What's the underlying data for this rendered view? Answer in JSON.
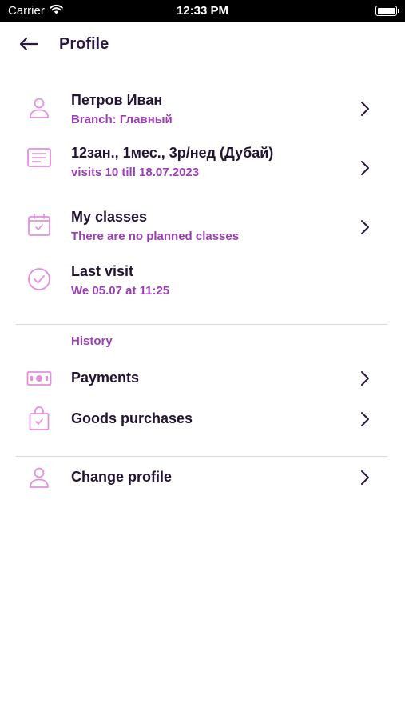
{
  "status_bar": {
    "carrier": "Carrier",
    "time": "12:33 PM"
  },
  "header": {
    "title": "Profile"
  },
  "profile": {
    "name": "Петров Иван",
    "branch": "Branch: Главный"
  },
  "subscription": {
    "title": "12зан., 1мес., 3р/нед (Дубай)",
    "subtitle": "visits 10 till 18.07.2023"
  },
  "classes": {
    "title": "My classes",
    "subtitle": "There are no planned classes"
  },
  "last_visit": {
    "title": "Last visit",
    "subtitle": "We 05.07 at 11:25"
  },
  "history": {
    "label": "History",
    "payments_label": "Payments",
    "goods_label": "Goods purchases"
  },
  "change_profile": {
    "label": "Change profile"
  },
  "colors": {
    "accent": "#e58ee0",
    "accent_text": "#9b3fb5",
    "title_text": "#241433",
    "divider": "#d9d6dc"
  },
  "icons": {
    "profile": "user-icon",
    "subscription": "document-icon",
    "classes": "calendar-icon",
    "last_visit": "check-circle-icon",
    "payments": "cash-icon",
    "goods": "shopping-bag-icon",
    "change_profile": "user-icon"
  }
}
